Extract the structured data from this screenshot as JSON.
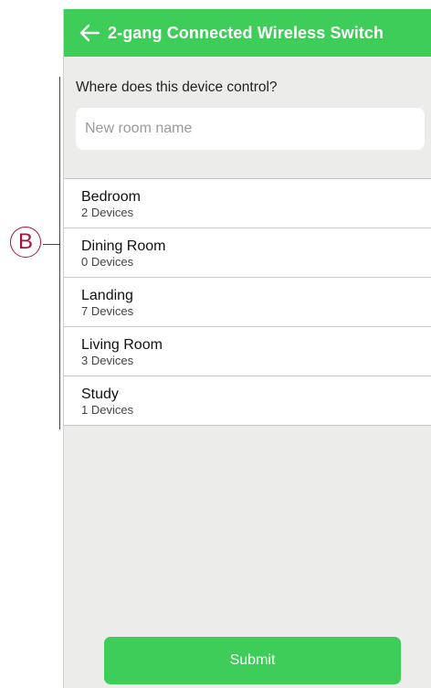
{
  "annotation": {
    "callout_label": "B",
    "color": "#a3153f"
  },
  "header": {
    "back_icon": "arrow-left-icon",
    "title": "2-gang Connected Wireless Switch",
    "background": "#3dcd58"
  },
  "form": {
    "prompt": "Where does this device control?",
    "new_room_input": {
      "value": "",
      "placeholder": "New room name"
    }
  },
  "rooms": [
    {
      "name": "Bedroom",
      "devices": "2 Devices"
    },
    {
      "name": "Dining Room",
      "devices": "0 Devices"
    },
    {
      "name": "Landing",
      "devices": "7 Devices"
    },
    {
      "name": "Living Room",
      "devices": "3 Devices"
    },
    {
      "name": "Study",
      "devices": "1 Devices"
    }
  ],
  "actions": {
    "submit_label": "Submit",
    "accent": "#3dcd58"
  }
}
